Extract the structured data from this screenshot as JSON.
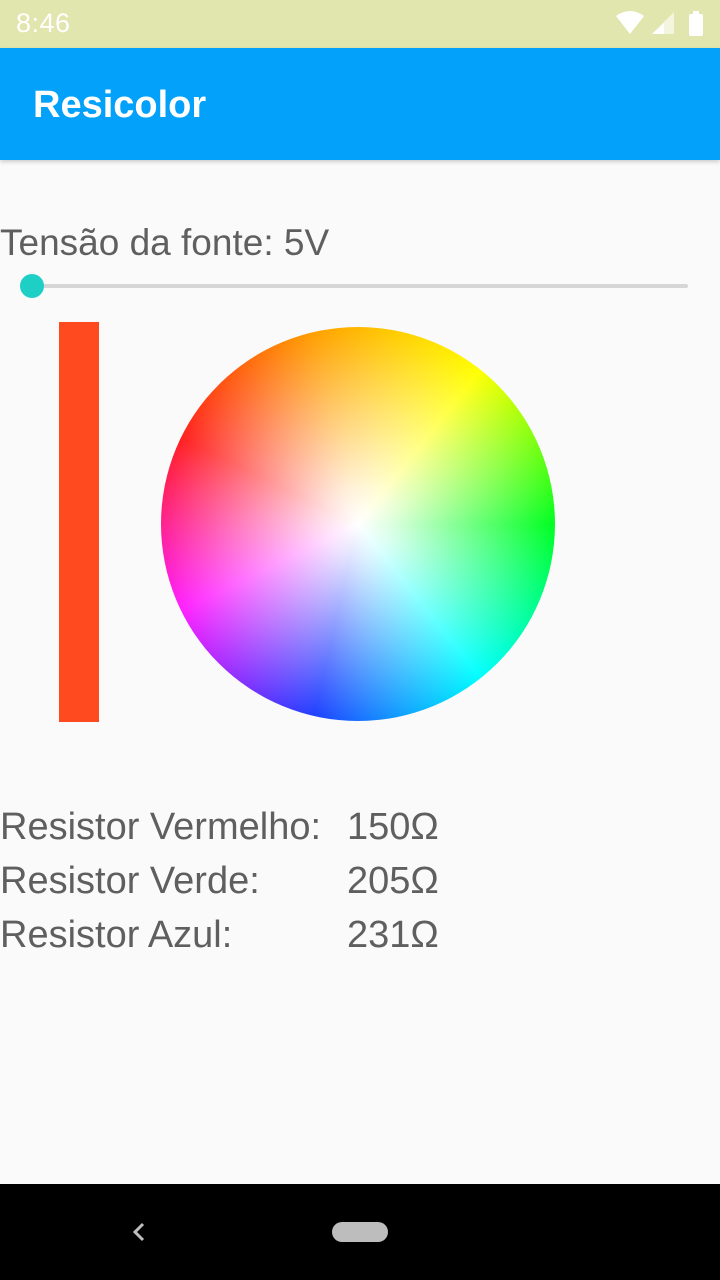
{
  "status_bar": {
    "time": "8:46",
    "icons": [
      "wifi-icon",
      "cell-signal-icon",
      "battery-icon"
    ]
  },
  "app_bar": {
    "title": "Resicolor",
    "color": "#03a1fa"
  },
  "voltage": {
    "label": "Tensão da fonte: 5V",
    "slider_fraction": 0.0
  },
  "selected_color": "#ff4a1f",
  "color_wheel": {
    "icon": "color-wheel"
  },
  "resistors": [
    {
      "label": "Resistor Vermelho:",
      "value": "150Ω"
    },
    {
      "label": "Resistor Verde:",
      "value": "205Ω"
    },
    {
      "label": "Resistor Azul:",
      "value": "231Ω"
    }
  ],
  "nav": {
    "icons": [
      "back-icon",
      "home-pill-icon"
    ]
  }
}
